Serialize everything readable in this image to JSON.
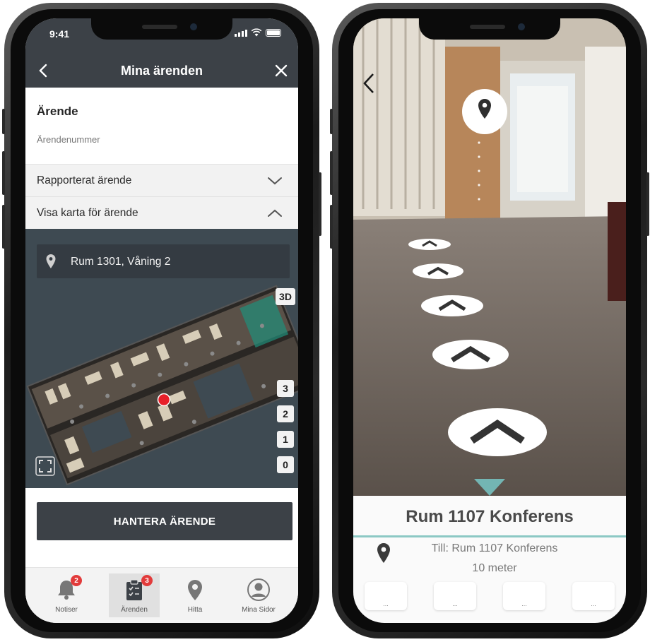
{
  "left_phone": {
    "status_time": "9:41",
    "nav": {
      "title": "Mina ärenden"
    },
    "case": {
      "heading": "Ärende",
      "number_label": "Ärendenummer"
    },
    "accordion": [
      {
        "label": "Rapporterat ärende",
        "state": "collapsed"
      },
      {
        "label": "Visa karta för ärende",
        "state": "expanded"
      }
    ],
    "map": {
      "location": "Rum 1301, Våning 2",
      "view_3d": "3D",
      "floors": [
        "3",
        "2",
        "1",
        "0"
      ],
      "marker_color": "#e8202a"
    },
    "primary_button": "HANTERA ÄRENDE",
    "tabs": [
      {
        "label": "Notiser",
        "icon": "bell-icon",
        "badge": "2"
      },
      {
        "label": "Ärenden",
        "icon": "clipboard-check-icon",
        "badge": "3"
      },
      {
        "label": "Hitta",
        "icon": "map-pin-icon"
      },
      {
        "label": "Mina Sidor",
        "icon": "user-avatar-icon"
      }
    ]
  },
  "right_phone": {
    "destination_title": "Rum 1107 Konferens",
    "to_text": "Till: Rum 1107 Konferens",
    "distance": "10 meter",
    "slots": [
      "...",
      "...",
      "...",
      "..."
    ]
  },
  "colors": {
    "header_dark": "#3c4147",
    "badge_red": "#e23b3b",
    "accent_teal": "#8cc8c4",
    "map_bg": "#3e4a52"
  }
}
